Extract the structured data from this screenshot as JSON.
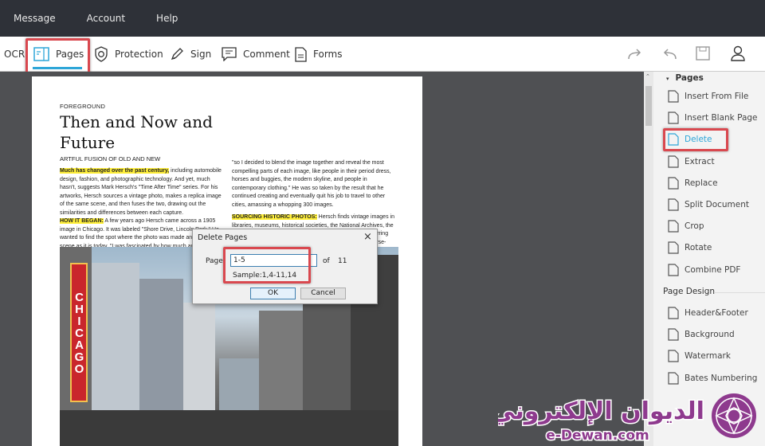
{
  "menubar": {
    "items": [
      "Message",
      "Account",
      "Help"
    ]
  },
  "toolbar": {
    "ocr": "OCR",
    "pages": "Pages",
    "protection": "Protection",
    "sign": "Sign",
    "comment": "Comment",
    "forms": "Forms",
    "icons": [
      "redo-icon",
      "undo-icon",
      "save-icon",
      "user-icon"
    ]
  },
  "document": {
    "kicker": "FOREGROUND",
    "title_line1": "Then and Now and",
    "title_line2": "Future",
    "subtitle": "ARTFUL FUSION OF OLD AND NEW",
    "col1_hl1": "Much has changed over the past century,",
    "col1_p1": " including automobile design, fashion, and photographic technology. And yet, much hasn't, suggests Mark Hersch's \"Time After Time\" series. For his artworks, Hersch sources a vintage photo, makes a replica image of the same scene, and then fuses the two, drawing out the similarities and differences between each capture.",
    "col1_hl2": "HOW IT BEGAN:",
    "col1_p2": " A few years ago Hersch came across a 1905 image in Chicago. It was labeled \"Shore Drive, Lincoln Park.\" He wanted to find the spot where the photo was made and reshoot the scene as it is today. \"I was fascinated by how much and how little had changed",
    "col2_p1": "\"so I decided to blend the image together and reveal the most compelling parts of each image, like people in their period dress, horses and buggies, the modern skyline, and people in contemporary clothing.\" He was so taken by the result that he continued creating and eventually quit his job to travel to other cities, amassing a whopping 300 images.",
    "col2_hl": "SOURCING HISTORIC PHOTOS:",
    "col2_p2": " Hersch finds vintage images in libraries, museums, historical societies, the National Archives, the Library of Congress, and private collections, he says, preferring those that include period reference points—cars, trains, horse-drawn",
    "sign_text": "CHICAGO"
  },
  "dialog": {
    "title": "Delete Pages",
    "page_label": "Page:",
    "page_value": "1-5",
    "of_label": "of",
    "total": "11",
    "sample": "Sample:1,4-11,14",
    "ok": "OK",
    "cancel": "Cancel"
  },
  "panel": {
    "section_pages": "Pages",
    "pages_items": [
      "Insert From File",
      "Insert Blank Page",
      "Delete",
      "Extract",
      "Replace",
      "Split Document",
      "Crop",
      "Rotate",
      "Combine PDF"
    ],
    "section_design": "Page Design",
    "design_items": [
      "Header&Footer",
      "Background",
      "Watermark",
      "Bates Numbering"
    ],
    "active_item": "Delete",
    "accent": "#2ea6d8"
  },
  "watermark": {
    "arabic": "الديوان الإلكتروني",
    "latin": "e-Dewan.com",
    "color": "#8e3a8e"
  },
  "colors": {
    "highlight_box": "#d9484f",
    "menubar": "#2e3138"
  }
}
